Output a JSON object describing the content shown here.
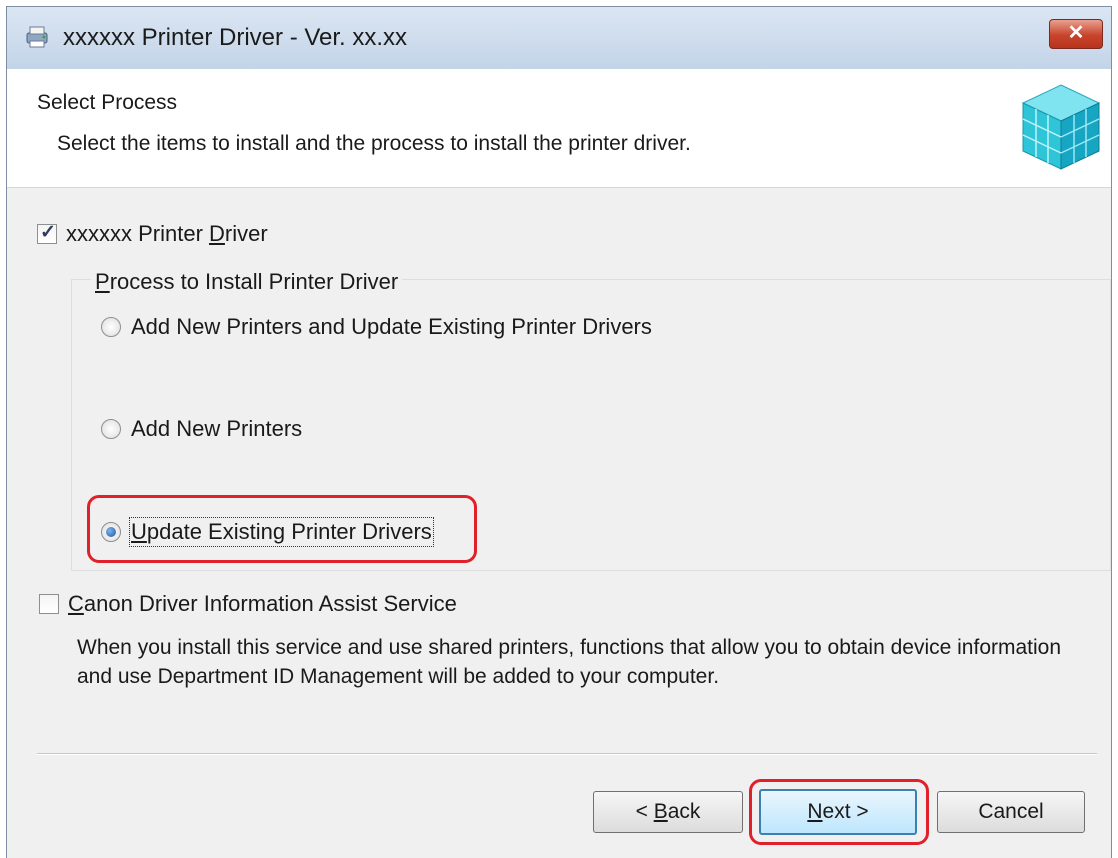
{
  "window": {
    "title": "xxxxxx Printer Driver - Ver. xx.xx",
    "close_label": "✕"
  },
  "header": {
    "title": "Select Process",
    "description": "Select the items to install and the process to install the printer driver."
  },
  "printer_driver": {
    "checked": true,
    "label_before": "xxxxxx Printer ",
    "label_accel": "D",
    "label_after": "river"
  },
  "process_group": {
    "legend_before": "",
    "legend_accel": "P",
    "legend_after": "rocess to Install Printer Driver",
    "options": [
      {
        "label": "Add New Printers and Update Existing Printer Drivers",
        "selected": false
      },
      {
        "label": "Add New Printers",
        "selected": false
      },
      {
        "label_before": "",
        "label_accel": "U",
        "label_after": "pdate Existing Printer Drivers",
        "selected": true
      }
    ]
  },
  "assist_service": {
    "checked": false,
    "label_before": "",
    "label_accel": "C",
    "label_after": "anon Driver Information Assist Service",
    "description": "When you install this service and use shared printers, functions that allow you to obtain device information and use Department ID Management will be added to your computer."
  },
  "buttons": {
    "back_before": "< ",
    "back_accel": "B",
    "back_after": "ack",
    "next_before": "",
    "next_accel": "N",
    "next_after": "ext >",
    "cancel": "Cancel"
  },
  "colors": {
    "highlight": "#e0202a",
    "title_bar": "#c3d4e8",
    "close_button": "#c7442c"
  }
}
